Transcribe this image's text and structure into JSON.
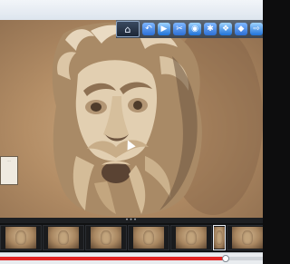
{
  "toolbar": {
    "selected_tool_icon": "camera-icon",
    "tools": [
      {
        "name": "rotate-icon",
        "glyph": "↶"
      },
      {
        "name": "slideshow-icon",
        "glyph": "▶"
      },
      {
        "name": "crop-icon",
        "glyph": "✂"
      },
      {
        "name": "redeye-icon",
        "glyph": "◉"
      },
      {
        "name": "adjust-icon",
        "glyph": "✱"
      },
      {
        "name": "effects-icon",
        "glyph": "❖"
      },
      {
        "name": "share-icon",
        "glyph": "◆"
      },
      {
        "name": "export-icon",
        "glyph": "⇨"
      }
    ]
  },
  "viewer": {
    "plaque_text": "·····"
  },
  "filmstrip": {
    "thumbnails": [
      {
        "label": ""
      },
      {
        "label": ""
      },
      {
        "label": ""
      },
      {
        "label": ""
      },
      {
        "label": ""
      },
      {
        "label": ""
      },
      {
        "label": ""
      }
    ],
    "active_index": 5
  },
  "scrollbar": {
    "position": 0.86
  },
  "colors": {
    "toolbar_bg": "#3d4550",
    "scrollbar_progress": "#e32625"
  }
}
